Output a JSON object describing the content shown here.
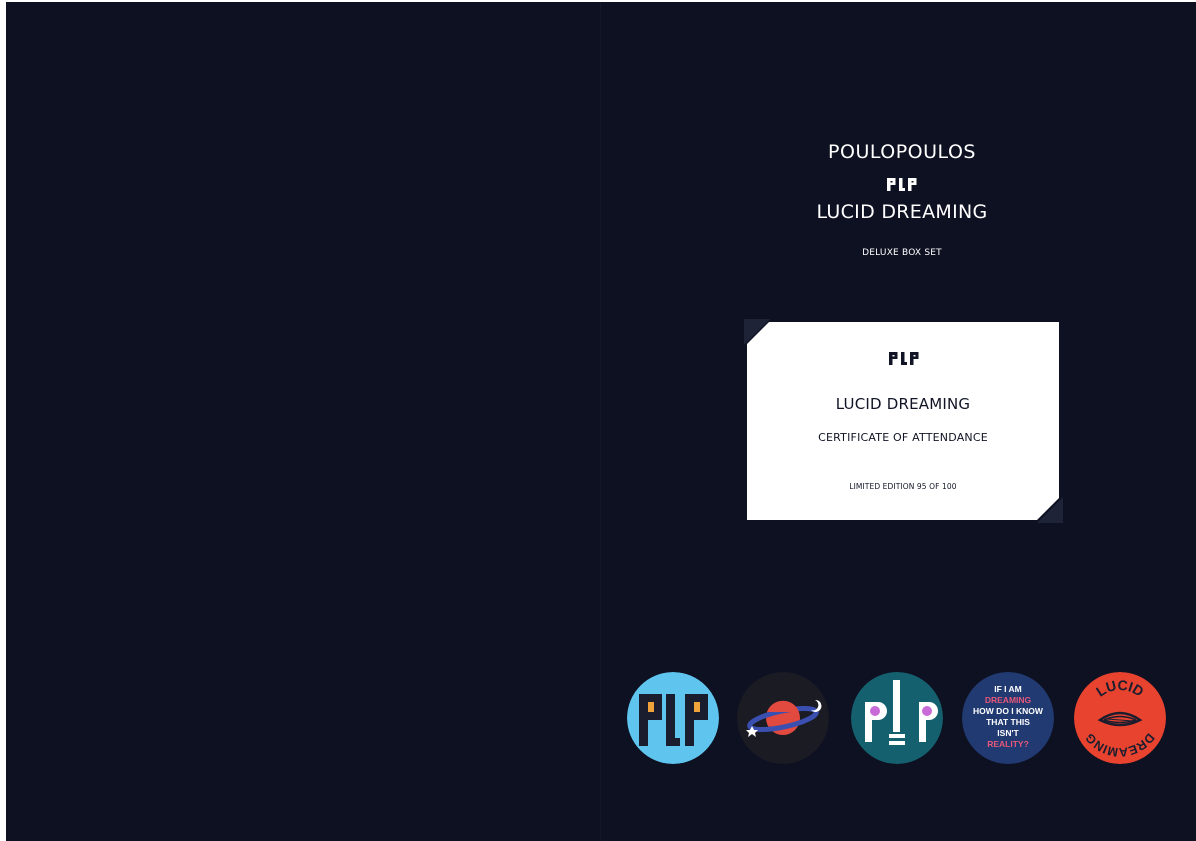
{
  "cover": {
    "artist": "POULOPOULOS",
    "logo": "PLP",
    "album": "LUCID DREAMING",
    "edition_label": "DELUXE BOX SET"
  },
  "certificate": {
    "logo": "PLP",
    "title": "LUCID DREAMING",
    "subtitle": "CERTIFICATE OF ATTENDANCE",
    "limited": "LIMITED EDITION 95 OF 100"
  },
  "badges": [
    {
      "kind": "plp-logo-badge",
      "text": "PLP",
      "bg": "#5fc5ee",
      "fg": "#1a1d2e",
      "accent": "#f0a23b"
    },
    {
      "kind": "planet-badge",
      "bg": "#1b1b24",
      "planet": "#e2493f",
      "ring": "#3a4fb0"
    },
    {
      "kind": "plp-teal-badge",
      "text": "PLP",
      "bg": "#15606e",
      "fg": "#ffffff",
      "accent": "#c86ad8"
    },
    {
      "kind": "reality-badge",
      "bg": "#213a72",
      "lines": [
        "IF I AM",
        "DREAMING",
        "HOW DO I KNOW",
        "THAT THIS",
        "ISN'T",
        "REALITY?"
      ],
      "highlight": "#e8577a"
    },
    {
      "kind": "lucid-dreaming-badge",
      "bg": "#e8432f",
      "fg": "#1a1d2e",
      "words": [
        "LUCID",
        "DREAMING"
      ]
    }
  ]
}
